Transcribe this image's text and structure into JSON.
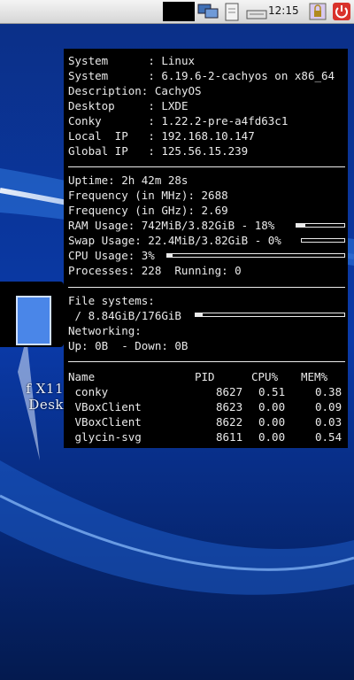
{
  "panel": {
    "clock": "12:15",
    "icons": [
      "network-icon",
      "clipboard-icon",
      "keyboard-icon",
      "lock-screen-icon",
      "power-icon"
    ]
  },
  "desktop": {
    "icon_label": "f X11 Desk"
  },
  "conky": {
    "system_info": [
      {
        "label": "System     ",
        "value": "Linux"
      },
      {
        "label": "System     ",
        "value": "6.19.6-2-cachyos on x86_64"
      },
      {
        "label": "Description",
        "value": "CachyOS"
      },
      {
        "label": "Desktop    ",
        "value": "LXDE"
      },
      {
        "label": "Conky      ",
        "value": "1.22.2-pre-a4fd63c1"
      },
      {
        "label": "Local  IP  ",
        "value": "192.168.10.147"
      },
      {
        "label": "Global IP  ",
        "value": "125.56.15.239"
      }
    ],
    "uptime": "Uptime: 2h 42m 28s",
    "freq_mhz": "Frequency (in MHz): 2688",
    "freq_ghz": "Frequency (in GHz): 2.69",
    "ram": {
      "text": "RAM Usage: 742MiB/3.82GiB - 18%",
      "percent": 18
    },
    "swap": {
      "text": "Swap Usage: 22.4MiB/3.82GiB - 0%",
      "percent": 0
    },
    "cpu": {
      "text": "CPU Usage: 3%",
      "percent": 3
    },
    "processes": "Processes: 228  Running: 0",
    "fs_header": "File systems:",
    "fs_root": {
      "text": " / 8.84GiB/176GiB",
      "percent": 5
    },
    "net_header": "Networking:",
    "net_line": "Up: 0B  - Down: 0B",
    "table": {
      "headers": [
        "Name",
        "PID",
        "CPU%",
        "MEM%"
      ],
      "rows": [
        {
          "name": " conky",
          "pid": "8627",
          "cpu": "0.51",
          "mem": "0.38"
        },
        {
          "name": " VBoxClient",
          "pid": "8623",
          "cpu": "0.00",
          "mem": "0.09"
        },
        {
          "name": " VBoxClient",
          "pid": "8622",
          "cpu": "0.00",
          "mem": "0.03"
        },
        {
          "name": " glycin-svg",
          "pid": "8611",
          "cpu": "0.00",
          "mem": "0.54"
        }
      ]
    }
  }
}
